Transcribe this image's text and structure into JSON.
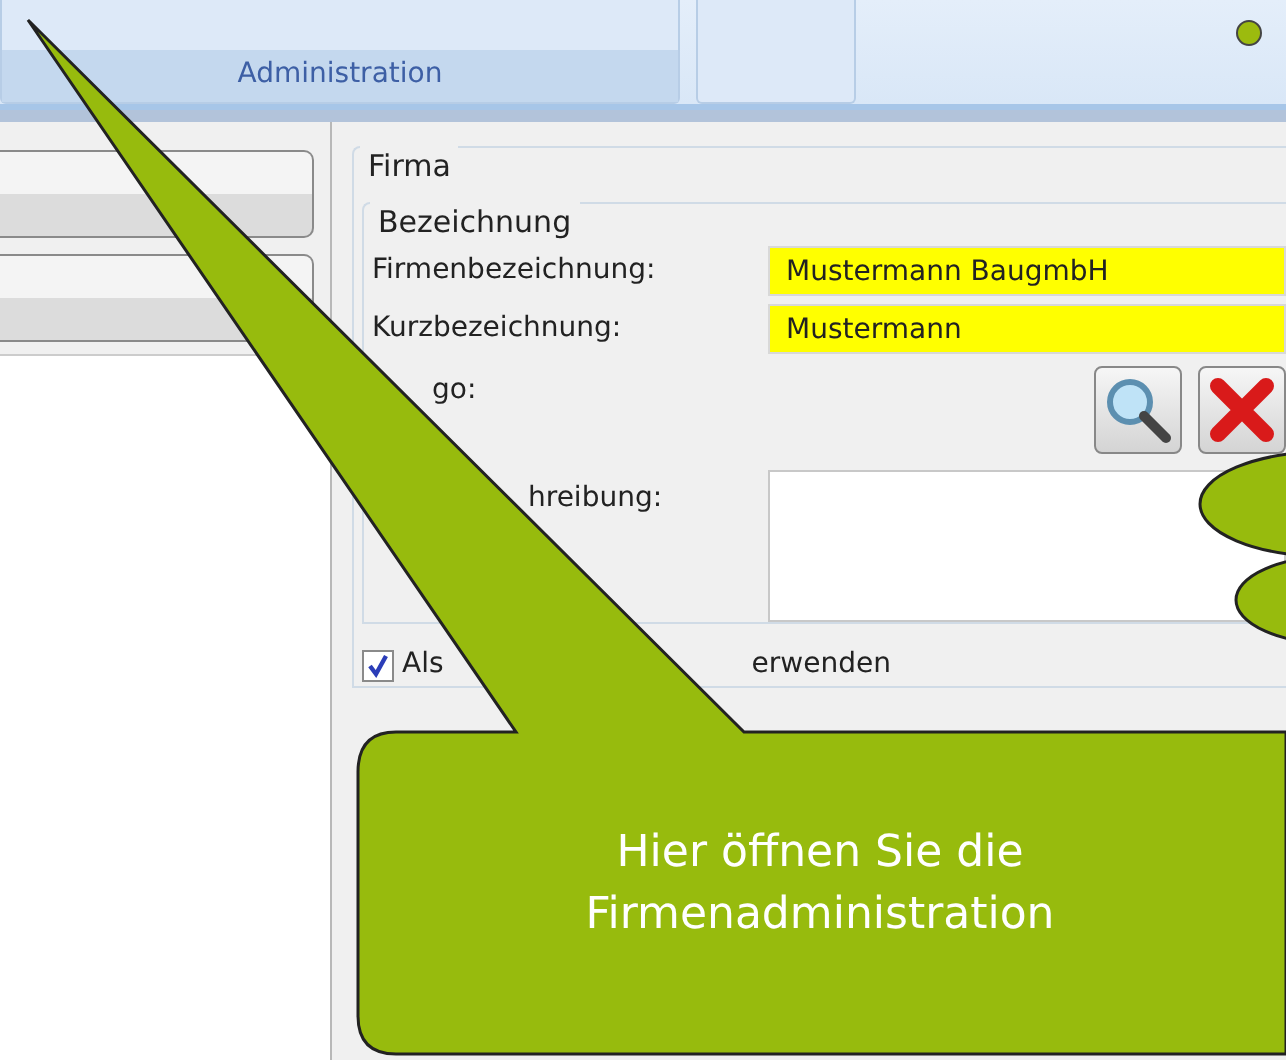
{
  "ribbon": {
    "groups": [
      {
        "label": "Administration"
      }
    ],
    "status_dot": {
      "color": "#9cbb0e"
    }
  },
  "firma": {
    "title": "Firma",
    "section": "Bezeichnung",
    "fields": [
      {
        "kind": "text",
        "label": "Firmenbezeichnung:",
        "value": "Mustermann BaugmbH"
      },
      {
        "kind": "text",
        "label": "Kurzbezeichnung:",
        "value": "Mustermann"
      },
      {
        "kind": "logo",
        "label": "go:"
      },
      {
        "kind": "textarea",
        "label": "hreibung:"
      }
    ],
    "checkbox": {
      "checked": true,
      "label_start": "Als",
      "label_end": "erwenden"
    }
  },
  "callout": {
    "text": "Hier öffnen Sie die Firmenadministration"
  }
}
